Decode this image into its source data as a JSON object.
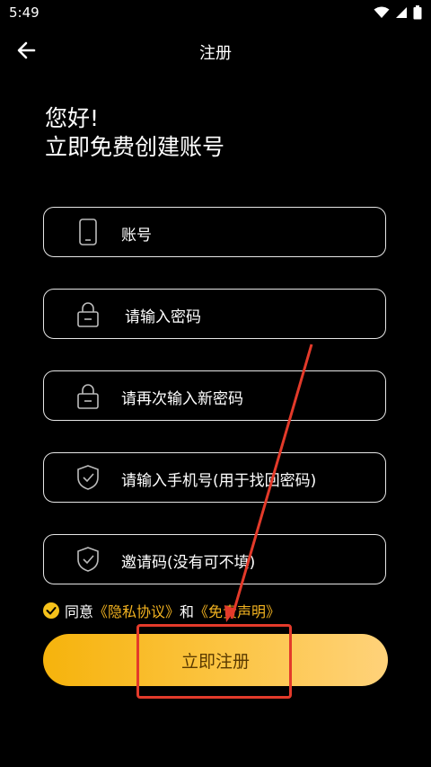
{
  "status": {
    "time": "5:49"
  },
  "nav": {
    "title": "注册"
  },
  "greeting": {
    "line1": "您好!",
    "line2": "立即免费创建账号"
  },
  "fields": {
    "account": "账号",
    "password": "请输入密码",
    "confirm_password": "请再次输入新密码",
    "phone": "请输入手机号(用于找回密码)",
    "invite_code": "邀请码(没有可不填)"
  },
  "agreement": {
    "prefix": "同意",
    "privacy_link": "《隐私协议》",
    "conjunction": "和",
    "disclaimer_link": "《免责声明》"
  },
  "register_button": "立即注册",
  "colors": {
    "accent": "#f6b30c",
    "annotation": "#e33a2a",
    "background": "#000000"
  }
}
